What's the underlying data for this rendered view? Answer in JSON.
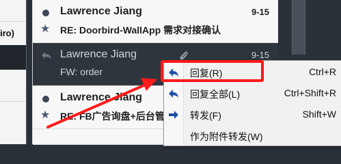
{
  "left_pane": {
    "fragment_text": "iro)"
  },
  "messages": [
    {
      "sender": "Lawrence Jiang",
      "date": "9-15",
      "subject": "RE: Doorbird-WallApp 需求对接确认",
      "state": "unread",
      "starred": true
    },
    {
      "sender": "Lawrence Jiang",
      "date": "9-15",
      "subject": "FW: order",
      "state": "selected",
      "has_attachment": true,
      "replied": true
    },
    {
      "sender": "Lawrence Jiang",
      "date": "",
      "subject": "RE: FB广告询盘+后台管",
      "state": "unread",
      "starred": true
    }
  ],
  "context_menu": {
    "items": [
      {
        "label": "回复(R)",
        "shortcut": "Ctrl+R",
        "icon": "reply-arrow-icon"
      },
      {
        "label": "回复全部(L)",
        "shortcut": "Ctrl+Shift+R",
        "icon": "reply-all-arrow-icon"
      },
      {
        "label": "转发(F)",
        "shortcut": "Shift+W",
        "icon": "forward-arrow-icon"
      },
      {
        "label": "作为附件转发(W)",
        "shortcut": "",
        "icon": ""
      }
    ]
  },
  "colors": {
    "highlight_border": "#ff1a1a",
    "menu_icon_blue": "#1f4fa8",
    "selected_row_bg": "#2f353d"
  }
}
